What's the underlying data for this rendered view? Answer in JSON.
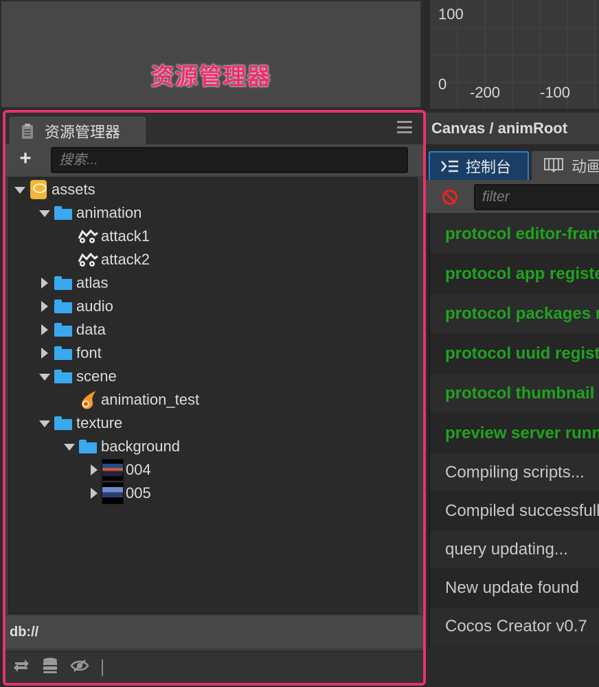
{
  "top_annotation": "资源管理器",
  "assets_panel": {
    "tab_label": "资源管理器",
    "search_placeholder": "搜索...",
    "add_label": "+",
    "footer_path": "db://",
    "tree": [
      {
        "label": "assets",
        "icon": "database-icon",
        "expanded": true
      },
      {
        "label": "animation",
        "icon": "folder-icon",
        "expanded": true
      },
      {
        "label": "attack1",
        "icon": "animation-clip-icon"
      },
      {
        "label": "attack2",
        "icon": "animation-clip-icon"
      },
      {
        "label": "atlas",
        "icon": "folder-icon",
        "expanded": false
      },
      {
        "label": "audio",
        "icon": "folder-icon",
        "expanded": false
      },
      {
        "label": "data",
        "icon": "folder-icon",
        "expanded": false
      },
      {
        "label": "font",
        "icon": "folder-icon",
        "expanded": false
      },
      {
        "label": "scene",
        "icon": "folder-icon",
        "expanded": true
      },
      {
        "label": "animation_test",
        "icon": "scene-fire-icon"
      },
      {
        "label": "texture",
        "icon": "folder-icon",
        "expanded": true
      },
      {
        "label": "background",
        "icon": "folder-icon",
        "expanded": true
      },
      {
        "label": "004",
        "icon": "image-thumbnail-icon",
        "expanded": false
      },
      {
        "label": "005",
        "icon": "image-thumbnail-icon",
        "expanded": false
      }
    ]
  },
  "graph": {
    "tick_100": "100",
    "tick_0": "0",
    "tick_m200": "-200",
    "tick_m100": "-100"
  },
  "breadcrumb": "Canvas / animRoot",
  "console": {
    "tab_console": "控制台",
    "tab_animation": "动画",
    "filter_placeholder": "filter",
    "logs": [
      {
        "text": "protocol editor-frame",
        "type": "green"
      },
      {
        "text": "protocol app registered",
        "type": "green"
      },
      {
        "text": "protocol packages registered",
        "type": "green"
      },
      {
        "text": "protocol uuid registered",
        "type": "green"
      },
      {
        "text": "protocol thumbnail registered",
        "type": "green"
      },
      {
        "text": "preview server running",
        "type": "green"
      },
      {
        "text": "Compiling scripts...",
        "type": "normal"
      },
      {
        "text": "Compiled successfully",
        "type": "normal"
      },
      {
        "text": "query updating...",
        "type": "normal"
      },
      {
        "text": "New update found",
        "type": "normal"
      },
      {
        "text": "Cocos Creator v0.7",
        "type": "normal"
      }
    ]
  },
  "colors": {
    "highlight": "#e8336a",
    "folder": "#3aa8ef",
    "log_green": "#1fa31f",
    "tab_active": "#1a3f67"
  }
}
